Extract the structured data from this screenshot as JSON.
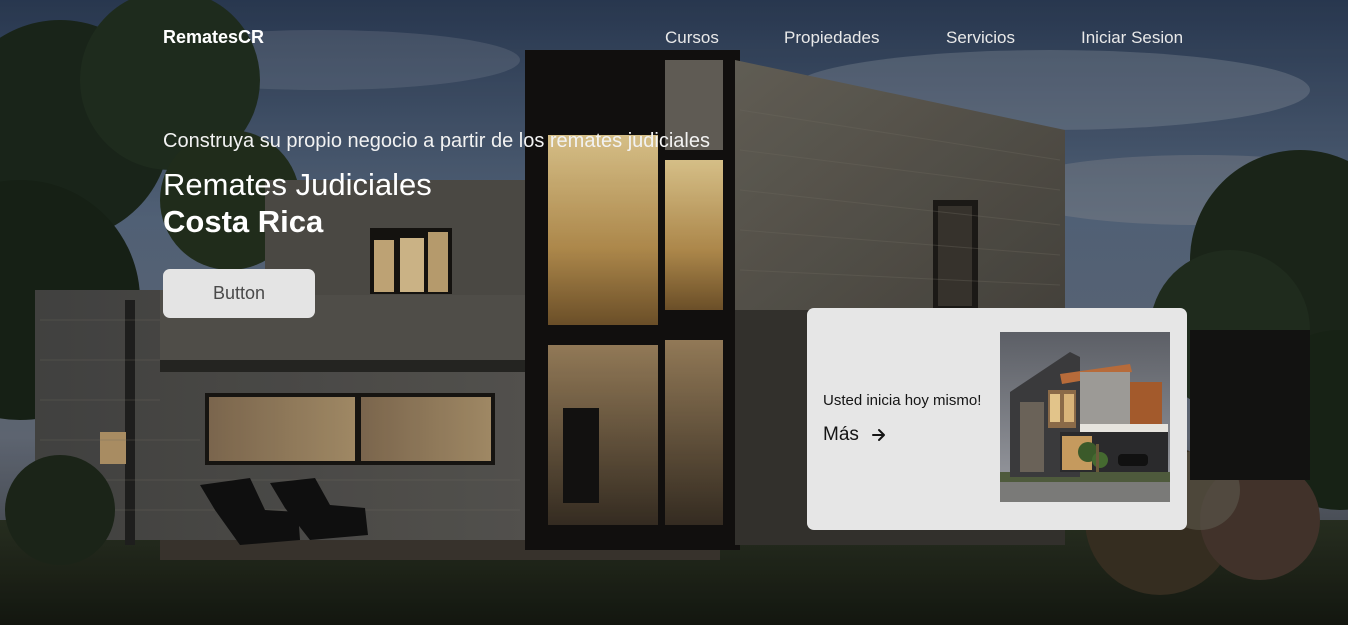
{
  "nav": {
    "logo": "RematesCR",
    "links": [
      {
        "label": "Cursos"
      },
      {
        "label": "Propiedades"
      },
      {
        "label": "Servicios"
      },
      {
        "label": "Iniciar Sesion"
      }
    ]
  },
  "hero": {
    "tagline": "Construya su propio negocio a partir de los remates judiciales",
    "title_line1": "Remates Judiciales",
    "title_line2": "Costa Rica",
    "button_label": "Button"
  },
  "promo": {
    "text": "Usted inicia hoy mismo!",
    "more_label": "Más",
    "more_icon": "arrow-right-icon"
  },
  "colors": {
    "card_bg": "#e6e6e6",
    "button_bg": "#e4e4e4",
    "text_light": "#ffffff"
  }
}
